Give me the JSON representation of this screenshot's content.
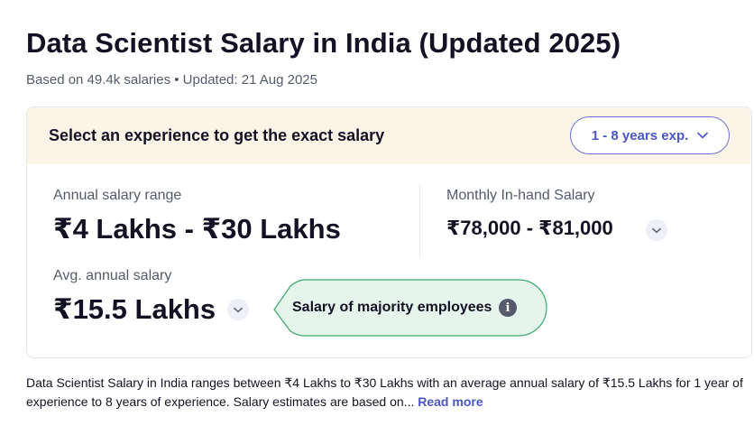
{
  "header": {
    "title": "Data Scientist Salary in India (Updated 2025)",
    "subtitle": "Based on 49.4k salaries • Updated: 21 Aug 2025"
  },
  "experience": {
    "prompt": "Select an experience to get the exact salary",
    "selected": "1 - 8 years exp."
  },
  "annual_range": {
    "label": "Annual salary range",
    "value": "₹4 Lakhs - ₹30 Lakhs"
  },
  "monthly": {
    "label": "Monthly In-hand Salary",
    "value": "₹78,000 - ₹81,000"
  },
  "average": {
    "label": "Avg. annual salary",
    "value": "₹15.5 Lakhs"
  },
  "tooltip": {
    "text": "Salary of majority employees",
    "icon": "i"
  },
  "description": {
    "text": "Data Scientist Salary in India ranges between ₹4 Lakhs to ₹30 Lakhs with an average annual salary of ₹15.5 Lakhs for 1 year of experience to 8 years of experience. Salary estimates are based on...",
    "read_more": "Read more"
  },
  "colors": {
    "accent": "#4a55c8",
    "header_bg": "#fdf4e8",
    "tooltip_bg": "#e6f5ec",
    "tooltip_border": "#3aa86b"
  }
}
